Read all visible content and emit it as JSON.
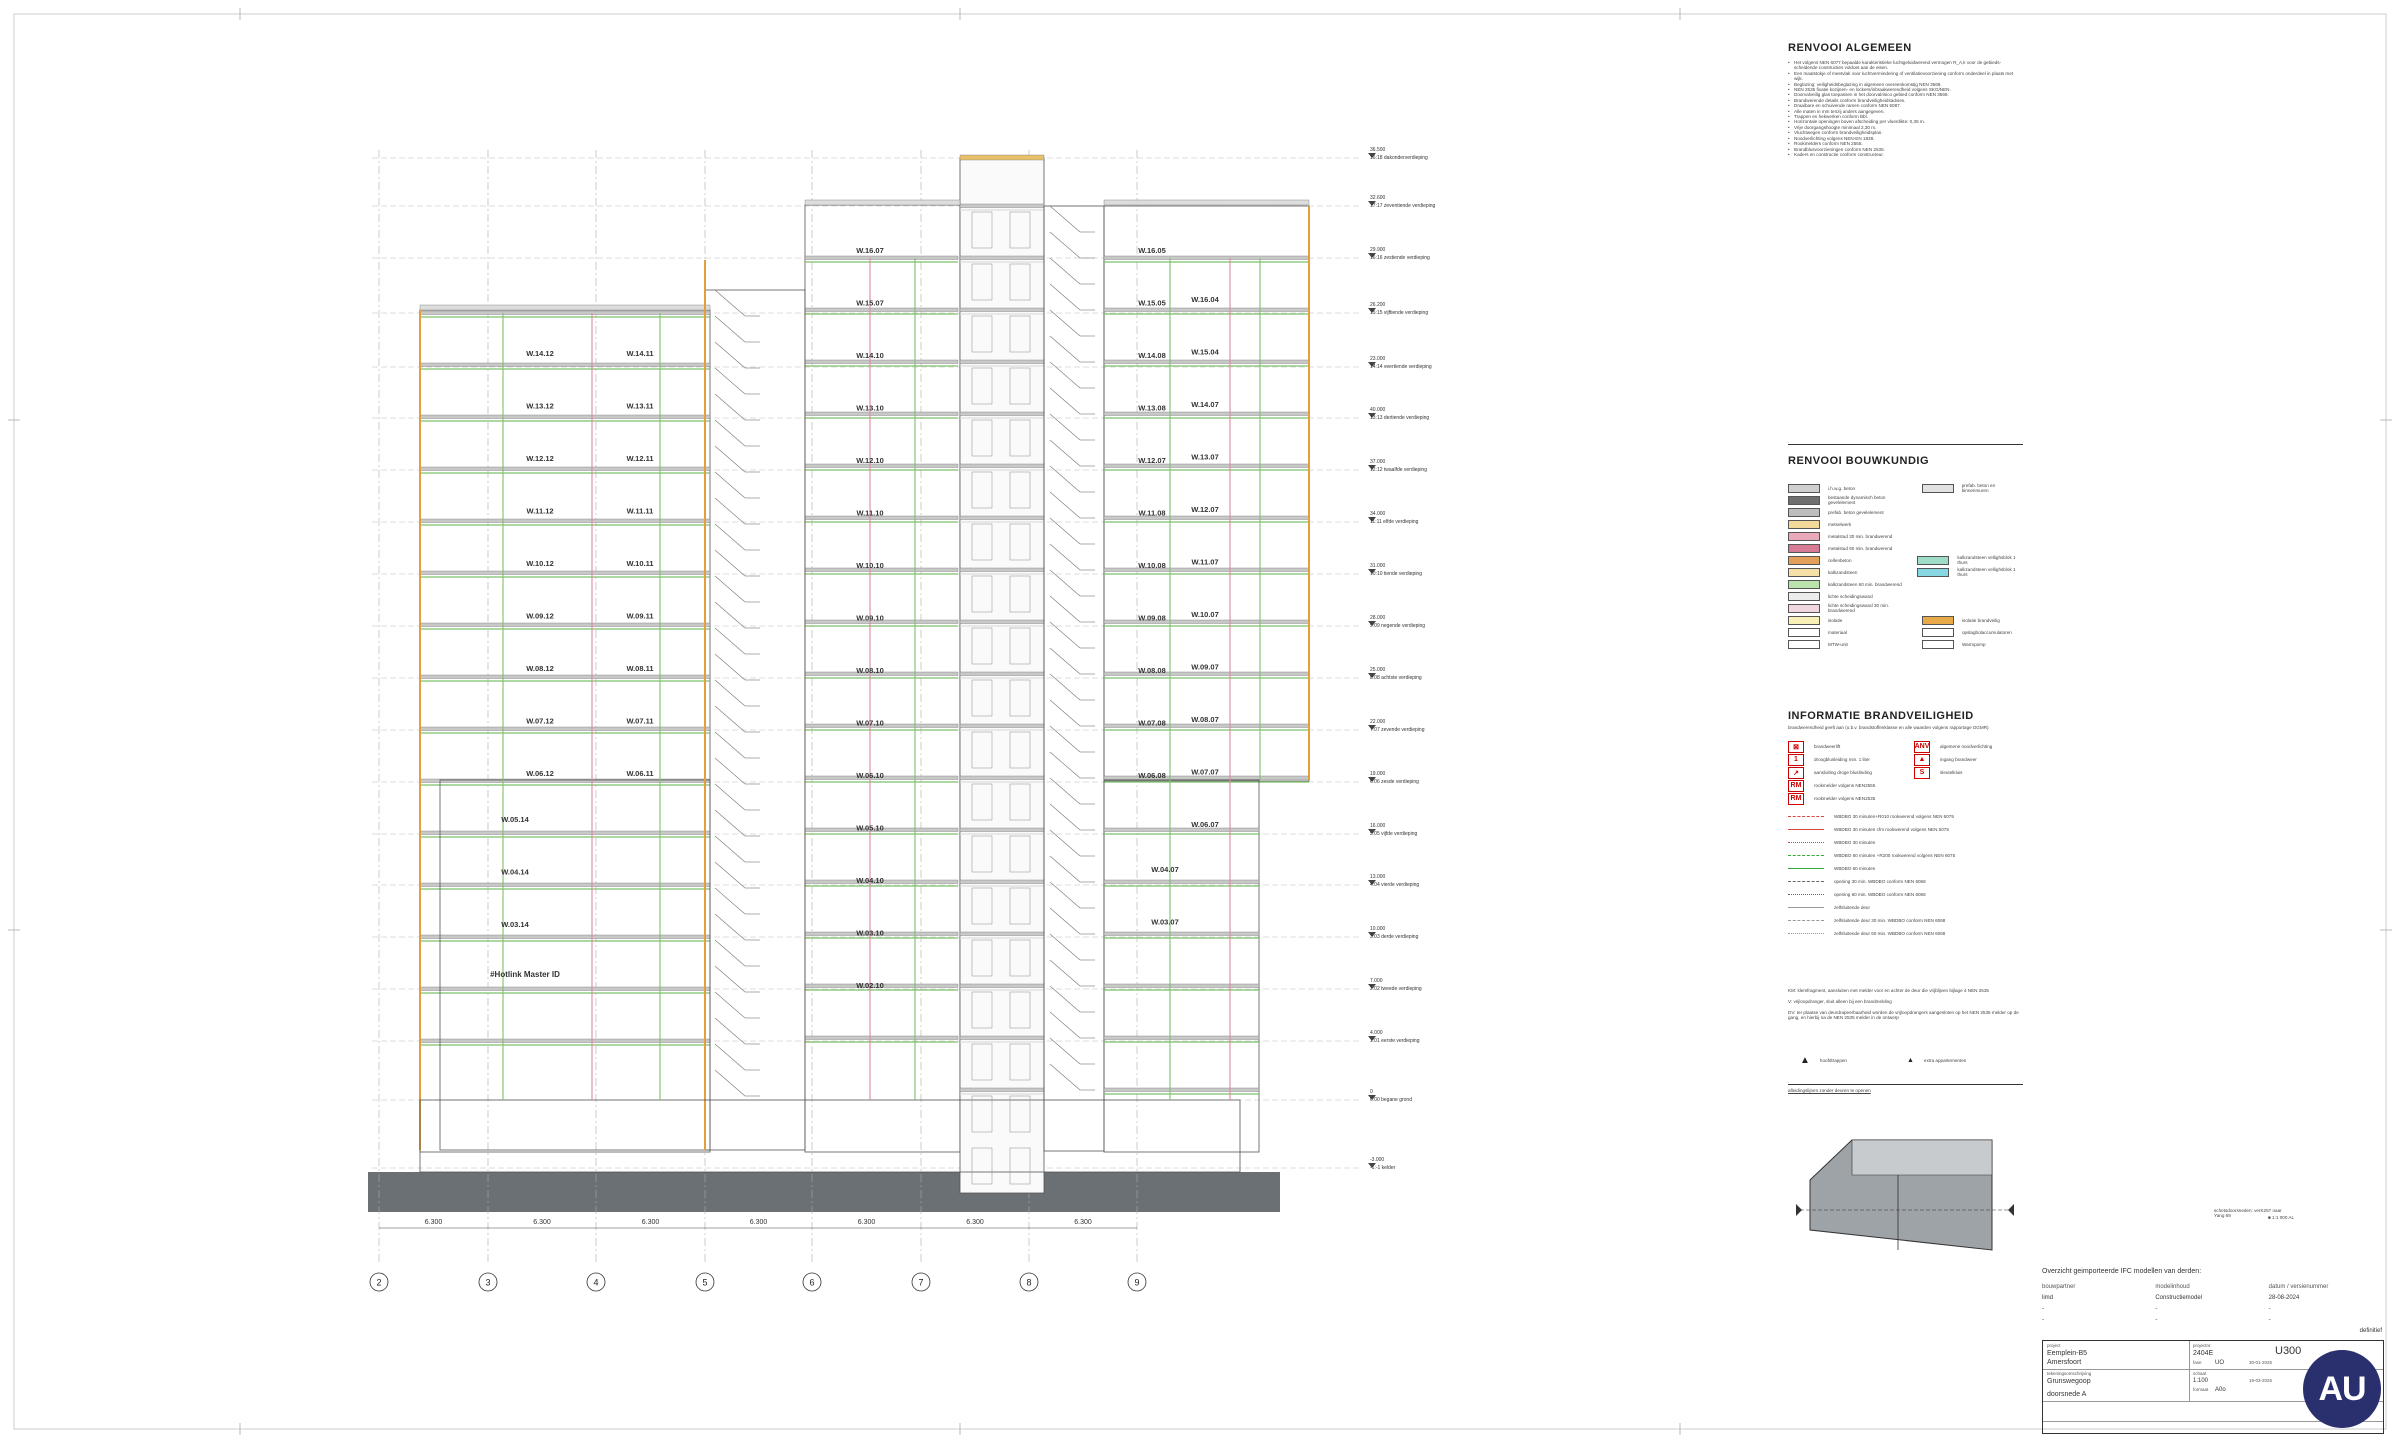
{
  "legend": {
    "general_title": "RENVOOI ALGEMEEN",
    "general_notes": [
      "Het volgens NEN 6077 bepaalde karakteristieke luchtgeluidwerend vermogen R_A,k voor de gebieds-scheidende constructies voldoet aan de eisen.",
      "Een maatstokje of meetvlak voor luchtvermindering of ventilatievoorziening conform onderdeel in plaats met wijk.",
      "Beglazing: veiligheidsbeglazing in algemeen overeenkomstig NEN 3569.",
      "NEN 2535 fixatie kozijnen- en lockers/inbraakwerendheid volgens SKG/NEN.",
      "Doorvalveilig glas toepassen in het doorvalrisico gebied conform NEN 3569.",
      "Brandwerende details conform brandveiligheidsadvies.",
      "Draaibare en schuivende ramen conform NEN 5087.",
      "Alle maten in mm tenzij anders aangegeven.",
      "Trappen en hekwerken conform Bbl.",
      "Horizontale openingen boven afscheiding per vloerdikte: 0,35 m.",
      "Vrije doorgangshoogte minimaal 2,30 m.",
      "Vluchtwegen conform brandveiligheidsplan.",
      "Noodverlichting volgens NEN-EN 1838.",
      "Rookmelders conform NEN 2555.",
      "Brandblusvoorzieningen conform NEN 2535.",
      "Kaders en constructie conform constructeur."
    ],
    "bouwkundig_title": "RENVOOI BOUWKUNDIG",
    "bouwkundig_items": [
      {
        "label": "i.h.w.g. beton",
        "color": "#cfcfcf",
        "label2": "prefab. beton en binnenmuren",
        "color2": "#e2e2e2"
      },
      {
        "label": "bestaande dynamisch beton gevelelement",
        "color": "#6f6f6f"
      },
      {
        "label": "prefab. beton gevelelement",
        "color": "#bdbdbd"
      },
      {
        "label": "metselwerk",
        "color": "#f3d99a"
      },
      {
        "label": "metalstud 30 min. brandwerend",
        "color": "#e9a9b9"
      },
      {
        "label": "metalstud 60 min. brandwerend",
        "color": "#d77b95"
      },
      {
        "label": "cellenbeton",
        "color": "#e4a05a",
        "label2": "kalkzandsteen vellighsblok 1 thurs",
        "color2": "#9fdcc9"
      },
      {
        "label": "kalkzandsteen",
        "color": "#f7e0a8",
        "label2": "kalkzandsteen vellighsblok 1 thurs",
        "color2": "#86d7e2"
      },
      {
        "label": "kalkzandsteen 60 min. brandwerend",
        "color": "#bde3ad"
      },
      {
        "label": "lichte scheidingswand",
        "color": "#ececec"
      },
      {
        "label": "lichte scheidingswand 30 min. brandwerend",
        "color": "#f0d7e0"
      },
      {
        "label": "isolatie",
        "color": "#f9f0b8",
        "label2": "isolatie brandveilig",
        "color2": "#e8a948"
      },
      {
        "label": "materiaal",
        "color": "#ffffff",
        "label2": "opslagbolaccumulatoren",
        "color2": "#ffffff"
      },
      {
        "label": "MTW-unit",
        "color": "#ffffff",
        "label2": "Warmpomp",
        "color2": "#ffffff"
      }
    ],
    "brand_title": "INFORMATIE BRANDVEILIGHEID",
    "brand_subtitle": "brandwerendheid geeft aan (o.b.v. brandstoffenklasse en alle waarden volgens rapportage DGMR)",
    "brand_items": [
      {
        "icon": "⊠",
        "label": "brandweerlift",
        "icon2": "ANV",
        "label2": "algemene noodverlichting"
      },
      {
        "icon": "1",
        "label": "droogblusleiding min. 1 liter",
        "icon2": "▲",
        "label2": "ingang brandweer"
      },
      {
        "icon": "↗",
        "label": "aansluiting droge bluslinding",
        "icon2": "S",
        "label2": "sleutelkluis"
      },
      {
        "icon": "RM",
        "label": "rookmelder volgens NEN2555"
      },
      {
        "icon": "RM",
        "label": "rookmelder volgens NEN2535"
      }
    ],
    "wbdbo_items": [
      {
        "color": "#d44",
        "style": "dashed",
        "label": "WBDBO 30 minuten+R010 rookwerend volgens NEN 6075"
      },
      {
        "color": "#d44",
        "style": "solid",
        "label": "WBDBO 30 minuten cfm rookwerend volgens NEN 6075"
      },
      {
        "color": "#d44",
        "style": "dotted",
        "label": "WBDBO 30 minuten"
      },
      {
        "color": "#3a3",
        "style": "dashed",
        "label": "WBDBO 60 minuten +R200 rookwerend volgens NEN 6075"
      },
      {
        "color": "#3a3",
        "style": "solid",
        "label": "WBDBO 60 minuten"
      },
      {
        "color": "#666",
        "style": "dashed",
        "label": "opening 30 min. WBDBO conform NEN 6068"
      },
      {
        "color": "#666",
        "style": "dotted",
        "label": "opening 60 min. WBDBO conform NEN 6068"
      },
      {
        "color": "#999",
        "style": "solid",
        "label": "zelfsluitende deur"
      },
      {
        "color": "#999",
        "style": "dashed",
        "label": "zelfsluitende deur 30 min. WBDBO conform NEN 6068"
      },
      {
        "color": "#999",
        "style": "dotted",
        "label": "zelfsluitende deur 60 min. WBDBO conform NEN 6068"
      }
    ],
    "brand_notes": [
      "KM: klemfragment, aansluiten met melder voor en achter de deur die vrijblijven bijlage 4 NEN 2535",
      "V: vrijloopdranger, sluit alleen bij een brandmelding",
      "DV: ter plaatse van deurdrapeerbaarheid worden de vrijloopdrangers aangesloten op het NEN 2535 melder op de gang, en hierbij na de NEN 2535 melder in de ontwerp"
    ],
    "brand_symbols": [
      {
        "label": "hoofdtrappen"
      },
      {
        "label": "extra appartementen"
      }
    ],
    "keyplan_label": "afleidingslijnen zonder deuren te openen",
    "keyplan_note": "schetsdoorsneden: verK257 naar Yang 69",
    "keyplan_ref": "■ 1:1 000 AL"
  },
  "ifc": {
    "title": "Overzicht geimporteerde IFC modellen van derden:",
    "headers": [
      "bouwpartner",
      "modelinhoud",
      "datum / versienummer"
    ],
    "rows": [
      [
        "limd",
        "Constructiemodel",
        "28-08-2024"
      ],
      [
        "-",
        "-",
        "-"
      ],
      [
        "-",
        "-",
        "-"
      ]
    ],
    "status": "definitief"
  },
  "titleblock": {
    "project_label": "project",
    "project_name": "Eemplein-B5",
    "city": "Amersfoort",
    "project_no_label": "projectnr.",
    "project_no": "2404E",
    "drawing_no": "U300",
    "phase_label": "fase",
    "phase": "UO",
    "date1": "30-01-2025",
    "subject_label": "tekeningsomschrijving",
    "subject": "Grunswegoop",
    "scale_label": "schaal",
    "scale": "1:100",
    "date2": "19-03-2025",
    "format_label": "formaat",
    "format": "A0o",
    "drawing_title": "doorsnede A",
    "firm": "AU"
  },
  "section": {
    "grid_labels": [
      "2",
      "3",
      "4",
      "5",
      "6",
      "7",
      "8",
      "9"
    ],
    "spans": [
      "6.300",
      "6.300",
      "6.300",
      "6.300",
      "6.300",
      "6.300",
      "6.300"
    ],
    "levels": [
      {
        "elev": "36.500",
        "name": "16:18 dakonderverdieping"
      },
      {
        "elev": "32.600",
        "name": "17:17 zeventiende verdieping"
      },
      {
        "elev": "29.900",
        "name": "16:16 zestiende verdieping"
      },
      {
        "elev": "26.200",
        "name": "15:15 vijftiende verdieping"
      },
      {
        "elev": "23.000",
        "name": "14:14 veertiende verdieping"
      },
      {
        "elev": "40.000",
        "name": "13:13 dertiende verdieping"
      },
      {
        "elev": "37.000",
        "name": "12:12 twaalfde verdieping"
      },
      {
        "elev": "34.000",
        "name": "11:11 elfde verdieping"
      },
      {
        "elev": "31.000",
        "name": "10:10 tiende verdieping"
      },
      {
        "elev": "28.000",
        "name": "9:09 negende verdieping"
      },
      {
        "elev": "25.000",
        "name": "8:08 achtste verdieping"
      },
      {
        "elev": "22.000",
        "name": "7:07 zevende verdieping"
      },
      {
        "elev": "19.000",
        "name": "6:06 zesde verdieping"
      },
      {
        "elev": "16.000",
        "name": "5:05 vijfde verdieping"
      },
      {
        "elev": "13.000",
        "name": "4:04 vierde verdieping"
      },
      {
        "elev": "10.000",
        "name": "3:03 derde verdieping"
      },
      {
        "elev": "7.000",
        "name": "2:02 tweede verdieping"
      },
      {
        "elev": "4.000",
        "name": "1:01 eerste verdieping"
      },
      {
        "elev": "0",
        "name": "0:00 begane grond"
      },
      {
        "elev": "-3.000",
        "name": "-1:-1 kelder"
      }
    ],
    "units_a": [
      "W.14.12",
      "W.13.12",
      "W.12.12",
      "W.11.12",
      "W.10.12",
      "W.09.12",
      "W.08.12",
      "W.07.12",
      "W.06.12",
      "W.05.14",
      "W.04.14",
      "W.03.14",
      "#Hotlink Master ID"
    ],
    "units_b": [
      "W.14.11",
      "W.13.11",
      "W.12.11",
      "W.11.11",
      "W.10.11",
      "W.09.11",
      "W.08.11",
      "W.07.11",
      "W.06.11"
    ],
    "units_c": [
      "W.16.07",
      "W.15.07",
      "W.14.10",
      "W.13.10",
      "W.12.10",
      "W.11.10",
      "W.10.10",
      "W.09.10",
      "W.08.10",
      "W.07.10",
      "W.06.10",
      "W.05.10",
      "W.04.10",
      "W.03.10",
      "W.02.10"
    ],
    "units_d": [
      "W.16.05",
      "W.15.05",
      "W.14.08",
      "W.13.08",
      "W.12.07",
      "W.11.08",
      "W.10.08",
      "W.09.08",
      "W.08.08",
      "W.07.08",
      "W.06.08",
      "W.04.07",
      "W.03.07"
    ],
    "units_e": [
      "W.16.04",
      "W.15.04",
      "W.14.07",
      "W.13.07",
      "W.12.07",
      "W.11.07",
      "W.10.07",
      "W.09.07",
      "W.08.07",
      "W.07.07",
      "W.06.07"
    ]
  }
}
